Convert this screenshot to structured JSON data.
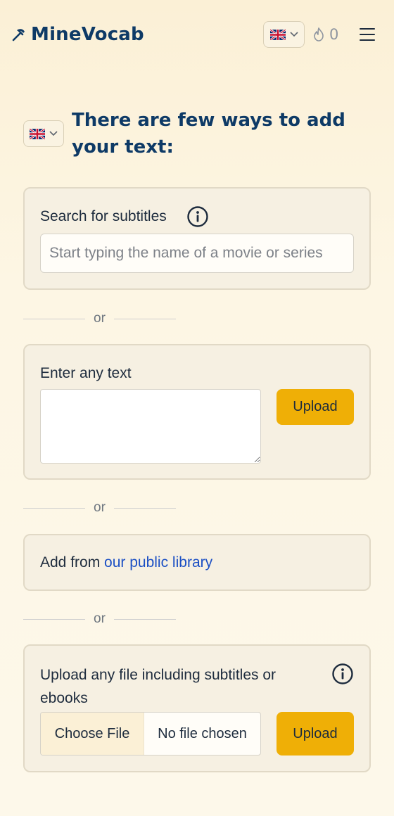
{
  "header": {
    "logo_text": "MineVocab",
    "streak_count": "0"
  },
  "intro": {
    "title": "There are few ways to add your text:"
  },
  "subtitles_card": {
    "label": "Search for subtitles",
    "search_placeholder": "Start typing the name of a movie or series"
  },
  "separators": {
    "or": "or"
  },
  "text_card": {
    "label": "Enter any text",
    "upload_label": "Upload"
  },
  "library_card": {
    "prefix": "Add from ",
    "link_text": "our public library"
  },
  "file_card": {
    "label": "Upload any file including subtitles or ebooks",
    "choose_file_label": "Choose File",
    "no_file_label": "No file chosen",
    "upload_label": "Upload"
  },
  "colors": {
    "accent": "#efaf06",
    "brand": "#0e3a66",
    "link": "#1b4fc4",
    "background": "#fdf6e4"
  },
  "icons": {
    "logo": "pickaxe-icon",
    "language": "uk-flag-icon",
    "streak": "flame-icon",
    "menu": "hamburger-menu-icon",
    "info": "info-icon"
  }
}
